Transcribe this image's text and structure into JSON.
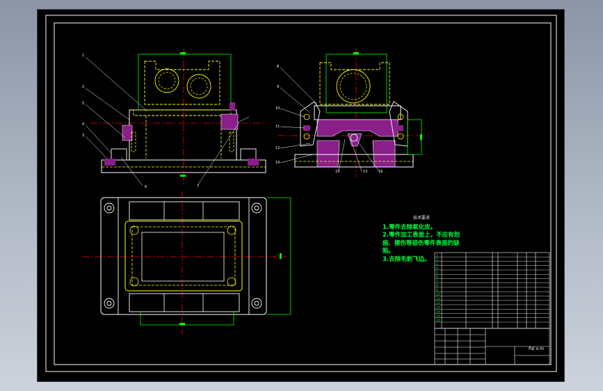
{
  "drawing": {
    "colors": {
      "background": "#000000",
      "outline": "#ffffff",
      "section": "#ffff00",
      "center": "#ff0000",
      "hidden": "#ffff00",
      "dimension": "#00ff00",
      "hatch": "#a020a0",
      "leader": "#ffffff",
      "notes_text": "#00ff3c"
    },
    "front_view_callouts": [
      "1",
      "2",
      "5",
      "4",
      "3",
      "6",
      "7"
    ],
    "side_view_callouts": [
      "8",
      "9",
      "10",
      "11",
      "12",
      "13",
      "14",
      "15",
      "16"
    ]
  },
  "technical_requirements": {
    "heading": "技术要求",
    "items": [
      "1.零件去除氧化皮。",
      "2.零件加工表面上，不应有划",
      "痕、擦伤等损伤零件表面的缺",
      "陷。",
      "3.去除毛刺飞边。"
    ]
  },
  "title_block": {
    "drawing_name": "Pal o m",
    "row_labels": [
      "1",
      "2",
      "3",
      "4",
      "5",
      "6",
      "7",
      "8",
      "9",
      "10",
      "11",
      "12",
      "13",
      "14",
      "15",
      "16"
    ]
  }
}
